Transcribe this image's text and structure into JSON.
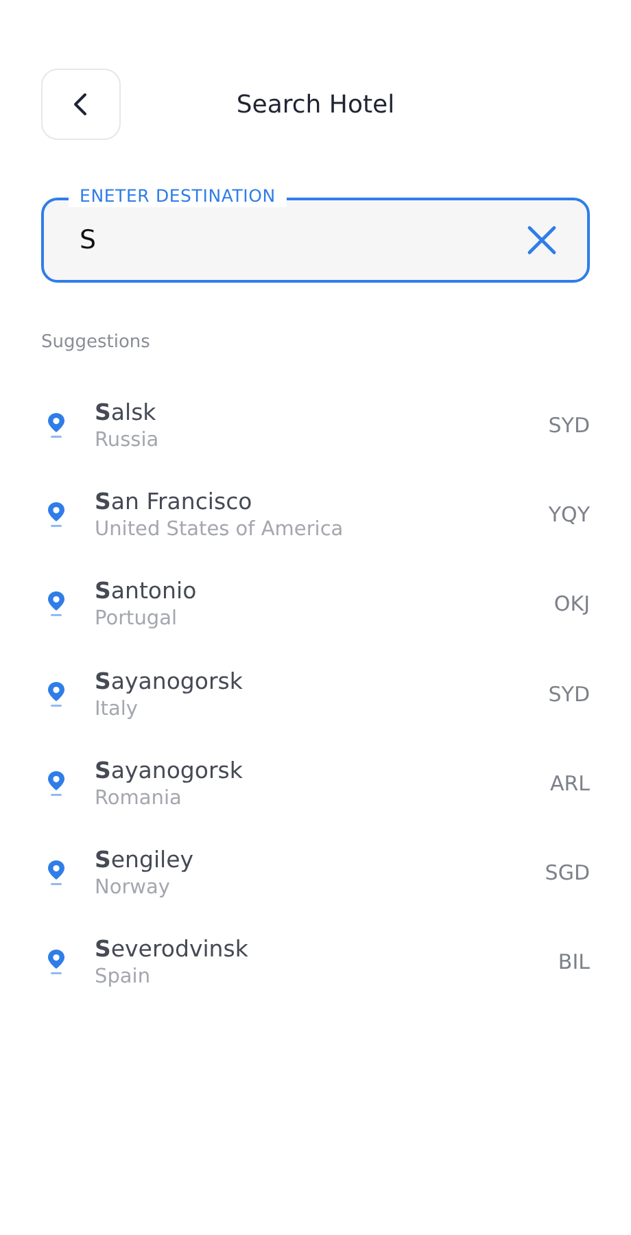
{
  "header": {
    "title": "Search Hotel"
  },
  "search": {
    "label": "ENETER DESTINATION",
    "value": "S"
  },
  "suggestions_title": "Suggestions",
  "suggestions": [
    {
      "city": "**S**alsk",
      "country": "Russia",
      "code": "SYD"
    },
    {
      "city": "**S**an Francisco",
      "country": "United States of America",
      "code": "YQY"
    },
    {
      "city": "**S**antonio",
      "country": "Portugal",
      "code": "OKJ"
    },
    {
      "city": "**S**ayanogorsk",
      "country": "Italy",
      "code": "SYD"
    },
    {
      "city": "**S**ayanogorsk",
      "country": "Romania",
      "code": "ARL"
    },
    {
      "city": "**S**engiley",
      "country": "Norway",
      "code": "SGD"
    },
    {
      "city": "**S**everodvinsk",
      "country": "Spain",
      "code": "BIL"
    }
  ]
}
